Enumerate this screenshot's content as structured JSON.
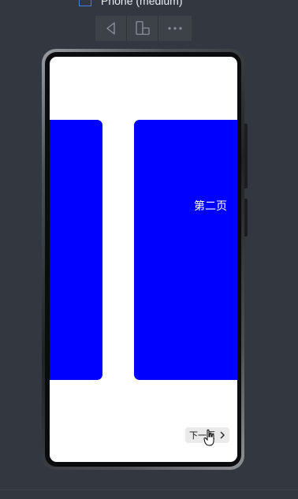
{
  "device": {
    "label": "Phone (medium)",
    "icon": "phone-icon"
  },
  "toolbar": {
    "buttons": [
      {
        "icon": "back-triangle-icon"
      },
      {
        "icon": "rotate-device-icon"
      },
      {
        "icon": "more-icon"
      }
    ]
  },
  "app": {
    "page_label": "第二页",
    "next_button_label": "下一页",
    "next_button_icon": "chevron-right-icon",
    "card_color": "#0000ff"
  }
}
